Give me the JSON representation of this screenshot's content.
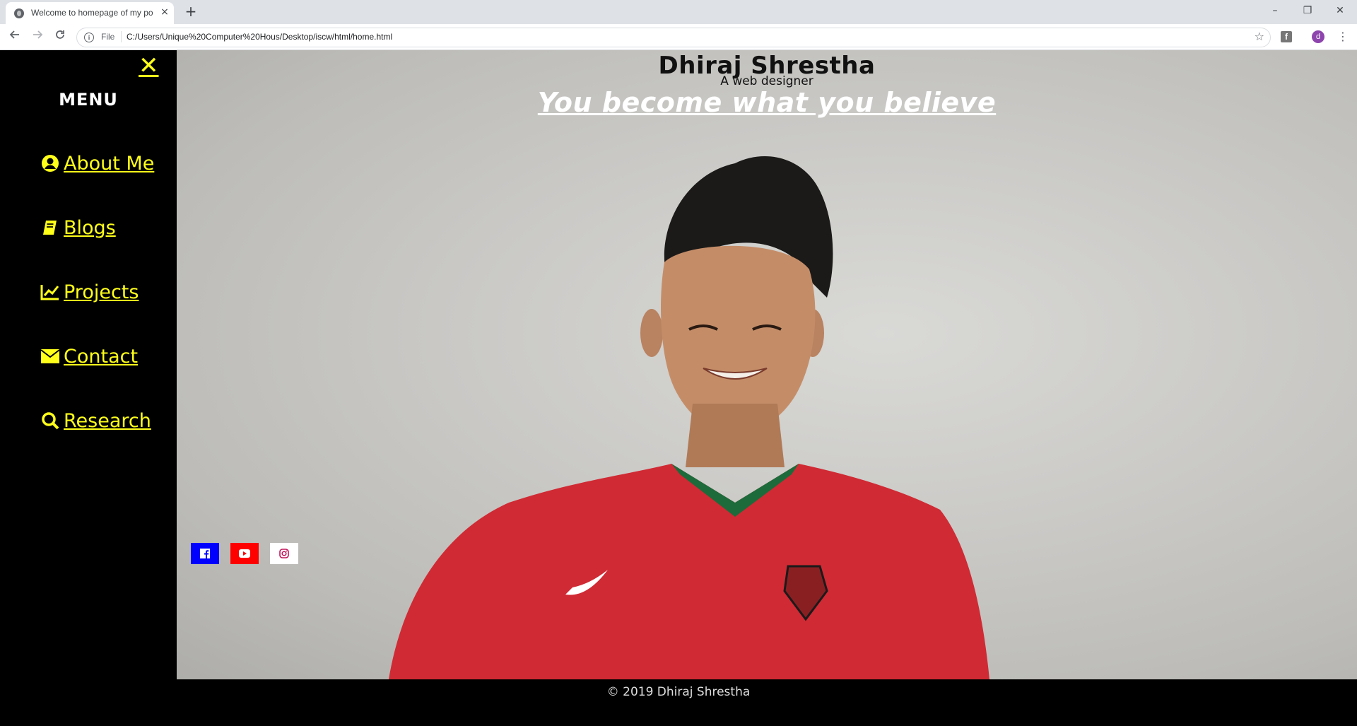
{
  "browser": {
    "tab_title": "Welcome to homepage of my po",
    "tab_close": "×",
    "new_tab": "+",
    "address_scheme": "File",
    "address_url": "C:/Users/Unique%20Computer%20Hous/Desktop/iscw/html/home.html",
    "profile_initial": "d",
    "window_controls": {
      "minimize": "–",
      "restore": "❐",
      "close": "✕"
    }
  },
  "sidebar": {
    "close_symbol": "✕",
    "menu_title": "MENU",
    "items": [
      {
        "label": "About Me",
        "icon": "user-circle-icon"
      },
      {
        "label": "Blogs",
        "icon": "book-icon"
      },
      {
        "label": "Projects",
        "icon": "line-chart-icon"
      },
      {
        "label": "Contact",
        "icon": "envelope-icon"
      },
      {
        "label": "Research",
        "icon": "search-icon"
      }
    ],
    "accent_color": "#ffff1a"
  },
  "hero": {
    "name": "Dhiraj Shrestha",
    "subtitle": "A web designer",
    "quote": "You become what you believe"
  },
  "social": [
    {
      "name": "facebook",
      "color": "#0000ff"
    },
    {
      "name": "youtube",
      "color": "#ff0000"
    },
    {
      "name": "instagram",
      "color": "#ffffff"
    }
  ],
  "footer": {
    "copyright": "© 2019 Dhiraj Shrestha"
  }
}
